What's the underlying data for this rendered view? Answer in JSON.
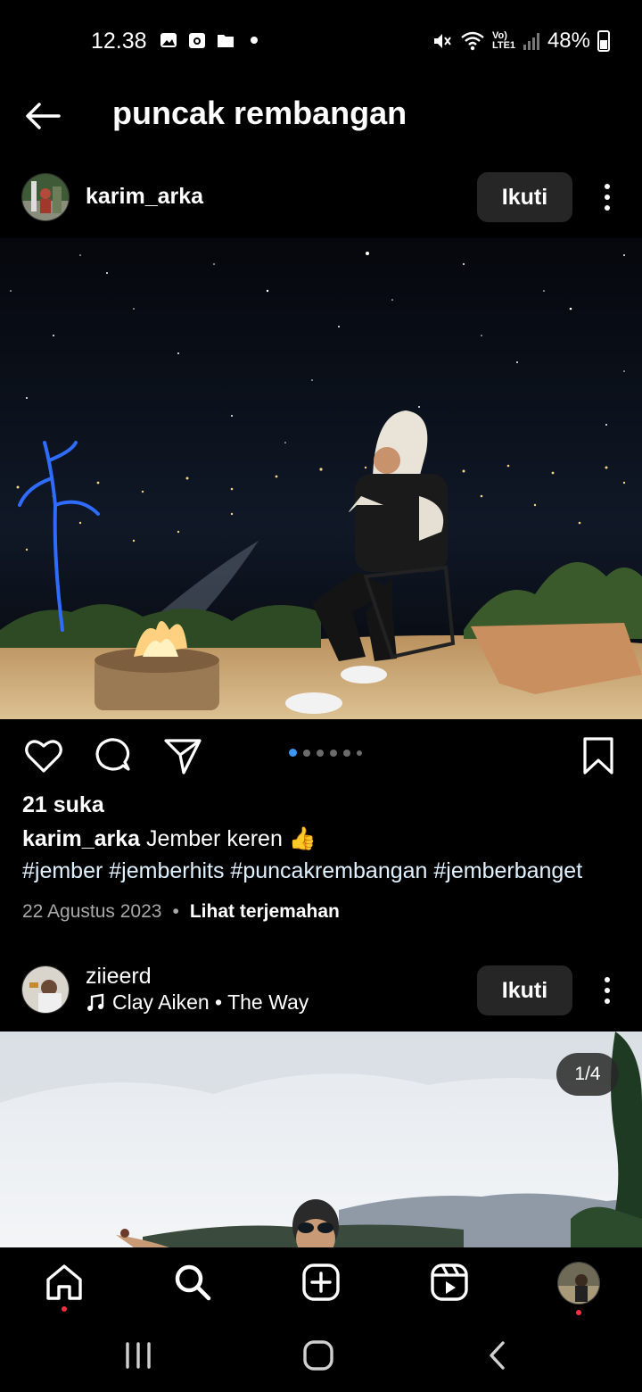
{
  "status_bar": {
    "time": "12.38",
    "battery": "48%",
    "network_label": "Vo) LTE1",
    "icons": [
      "gallery-icon",
      "camera-icon",
      "folder-icon",
      "dot-icon",
      "mute-icon",
      "wifi-icon",
      "volte-icon",
      "signal-icon",
      "battery-icon"
    ]
  },
  "header": {
    "title": "puncak rembangan",
    "back_icon": "arrow-left-icon"
  },
  "posts": [
    {
      "username": "karim_arka",
      "follow_label": "Ikuti",
      "likes": "21 suka",
      "caption_user": "karim_arka",
      "caption_text": "Jember keren 👍",
      "hashtags": "#jember #jemberhits #puncakrembangan #jemberbanget",
      "date": "22 Agustus 2023",
      "separator": "•",
      "translate_label": "Lihat terjemahan",
      "carousel_active_index": 0
    },
    {
      "username": "ziieerd",
      "music": "Clay Aiken • The Way",
      "follow_label": "Ikuti",
      "image_counter": "1/4"
    }
  ],
  "bottom_nav": {
    "items": [
      "home-icon",
      "search-icon",
      "add-post-icon",
      "reels-icon",
      "profile-avatar"
    ]
  },
  "system_nav": {
    "items": [
      "recents-icon",
      "home-circle-icon",
      "back-chevron-icon"
    ]
  },
  "colors": {
    "background": "#000000",
    "button": "#262626",
    "carousel_active": "#3897f0",
    "notification_dot": "#ff3040",
    "hashtag": "#e0f1ff"
  }
}
